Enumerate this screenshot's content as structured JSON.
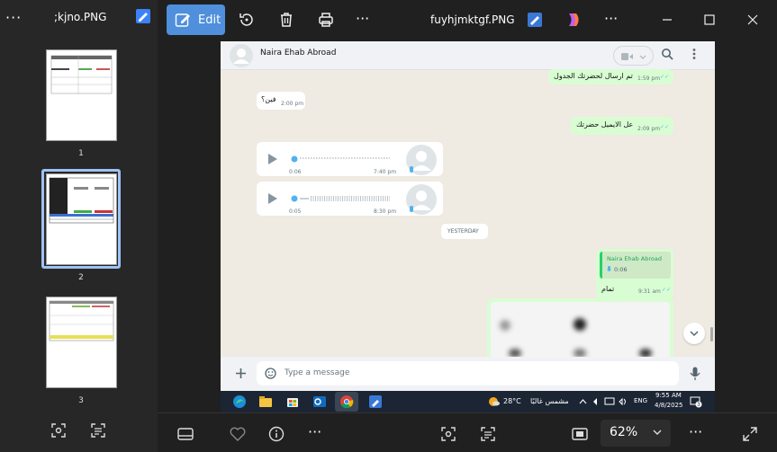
{
  "left_panel": {
    "more": "···",
    "file_title": ";kjno.PNG",
    "pages": [
      "1",
      "2",
      "3"
    ]
  },
  "toolbar": {
    "edit_label": "Edit",
    "more": "···",
    "file_title": "fuyhjmktgf.PNG",
    "more2": "···"
  },
  "bottom": {
    "zoom_value": "62%",
    "more": "···",
    "more2": "···"
  },
  "chat": {
    "contact_name": "Naira Ehab Abroad",
    "messages": [
      {
        "text": "تم ارسال لحضرتك الجدول",
        "time": "1:59 pm",
        "dir": "out"
      },
      {
        "text": "فين؟",
        "time": "2:00 pm",
        "dir": "in"
      },
      {
        "text": "عل الايميل حضرتك",
        "time": "2:09 pm",
        "dir": "out"
      }
    ],
    "voice_notes": [
      {
        "duration": "0:06",
        "time": "7:40 pm"
      },
      {
        "duration": "0:05",
        "time": "8:30 pm"
      }
    ],
    "day_separator": "YESTERDAY",
    "reply_name": "Naira Ehab Abroad",
    "reply_duration": "0:06",
    "reply_text": "تمام",
    "reply_time": "9:31 am",
    "composer_placeholder": "Type a message"
  },
  "taskbar": {
    "weather_temp": "28°C",
    "weather_text": "مشمس غالبًا",
    "lang": "ENG",
    "time": "9:55 AM",
    "date": "4/8/2025",
    "notif_count": "3"
  },
  "colors": {
    "accent": "#4f8fdc",
    "outgoing_bubble": "#d9fdd3",
    "chat_bg": "#efeae2",
    "whatsapp_green": "#25d366"
  }
}
